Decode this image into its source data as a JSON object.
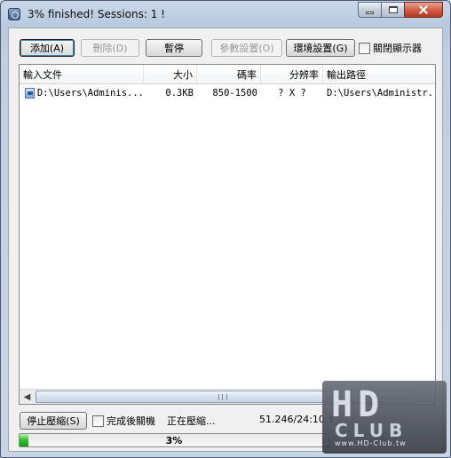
{
  "window": {
    "title": "3% finished! Sessions: 1 !"
  },
  "toolbar": {
    "add_label": "添加(A)",
    "delete_label": "刪除(D)",
    "pause_label": "暫停",
    "params_label": "參數設置(O)",
    "env_label": "環境設置(G)",
    "close_display_label": "關閉顯示器"
  },
  "list": {
    "columns": [
      "輸入文件",
      "大小",
      "碼率",
      "分辨率",
      "輸出路徑"
    ],
    "rows": [
      {
        "input": "D:\\Users\\Adminis...",
        "size": "0.3KB",
        "bitrate": "850-1500",
        "resolution": "? X ?",
        "output": "D:\\Users\\Administr..."
      }
    ]
  },
  "status": {
    "stop_label": "停止壓縮(S)",
    "shutdown_label": "完成後關機",
    "state_text": "正在壓縮...",
    "time_text": "51.246/24:10.1"
  },
  "progress": {
    "value": 0.03,
    "text": "3%"
  },
  "watermark": {
    "hd": "HD",
    "club": "CLUB",
    "url": "www.HD-Club.tw"
  }
}
